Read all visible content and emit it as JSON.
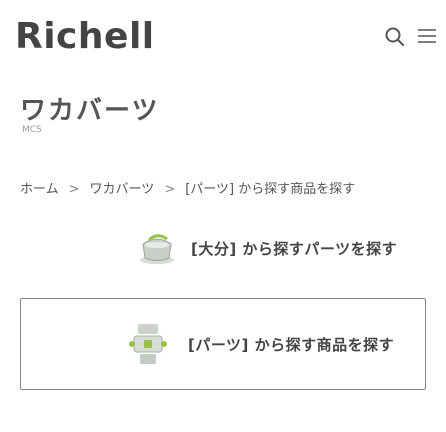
{
  "header": {
    "logo_text": "Richell",
    "search_icon": "search-icon",
    "menu_icon": "hamburger-menu-icon"
  },
  "page": {
    "title": "ワカバーツ",
    "subtitle": "MCS"
  },
  "breadcrumb": {
    "items": [
      "ホーム",
      "ワカバーツ",
      "[パーツ] から探す商品を探す"
    ]
  },
  "category": {
    "label": "[大分] から探すパーツを探す",
    "icon": "pot-icon"
  },
  "card": {
    "label": "[パーツ] から探す商品を探す",
    "icon": "parts-thumbnail-icon"
  },
  "colors": {
    "text": "#444444",
    "muted": "#999999",
    "border": "#7a8a8a",
    "accent_green": "#9cc24a"
  }
}
